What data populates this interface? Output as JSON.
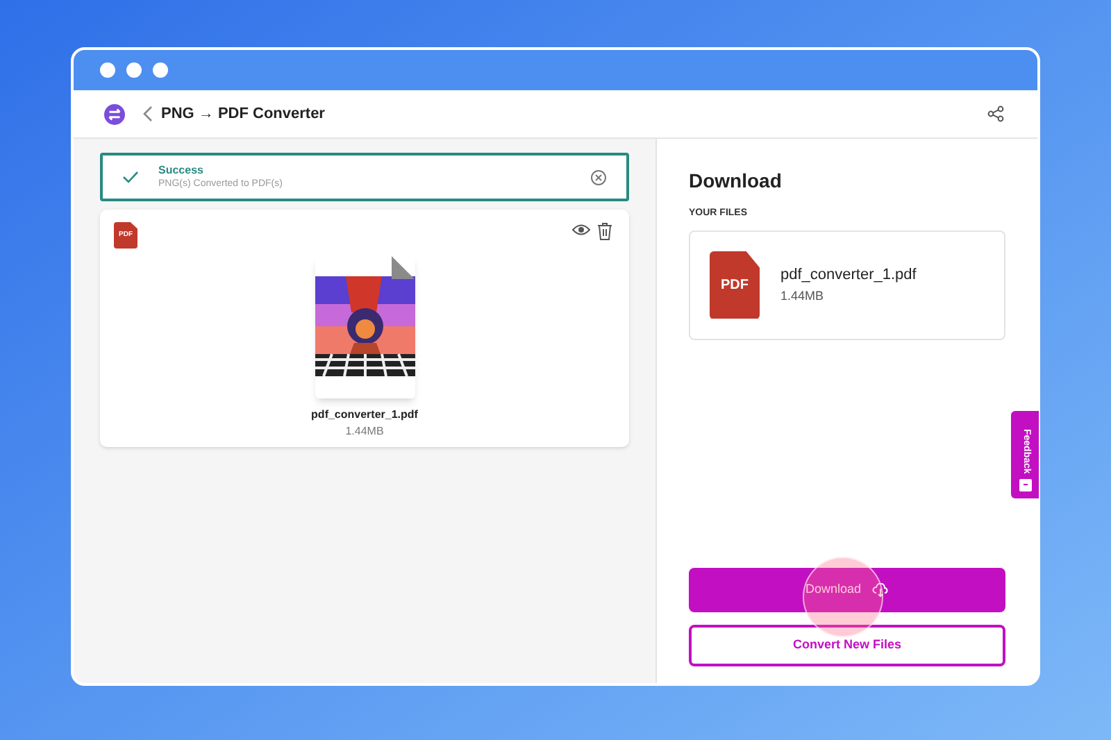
{
  "header": {
    "title": "PNG → PDF Converter"
  },
  "alert": {
    "title": "Success",
    "message": "PNG(s) Converted to PDF(s)"
  },
  "preview": {
    "badge": "PDF",
    "file_name": "pdf_converter_1.pdf",
    "size": "1.44MB"
  },
  "download_panel": {
    "title": "Download",
    "section_label": "YOUR FILES",
    "files": [
      {
        "icon_label": "PDF",
        "name": "pdf_converter_1.pdf",
        "size": "1.44MB"
      }
    ]
  },
  "buttons": [
    {
      "kind": "primary",
      "label": "Download"
    },
    {
      "kind": "outline",
      "label": "Convert New Files"
    }
  ],
  "feedback_tab": {
    "label": "Feedback"
  }
}
